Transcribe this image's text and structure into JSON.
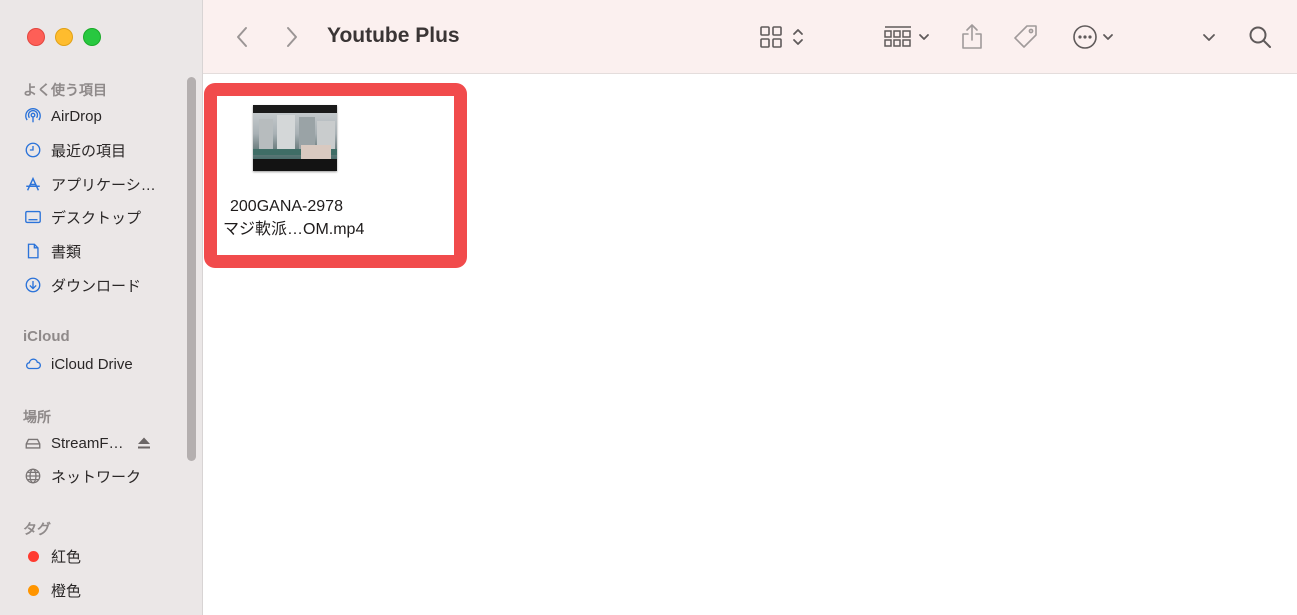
{
  "window": {
    "title": "Youtube Plus"
  },
  "sidebar": {
    "sections": [
      {
        "header": "よく使う項目",
        "items": [
          {
            "label": "AirDrop",
            "icon": "airdrop-icon"
          },
          {
            "label": "最近の項目",
            "icon": "clock-icon"
          },
          {
            "label": "アプリケーシ…",
            "icon": "applications-icon"
          },
          {
            "label": "デスクトップ",
            "icon": "desktop-icon"
          },
          {
            "label": "書類",
            "icon": "document-icon"
          },
          {
            "label": "ダウンロード",
            "icon": "download-icon"
          }
        ]
      },
      {
        "header": "iCloud",
        "items": [
          {
            "label": "iCloud Drive",
            "icon": "cloud-icon"
          }
        ]
      },
      {
        "header": "場所",
        "items": [
          {
            "label": "StreamF…",
            "icon": "drive-icon"
          },
          {
            "label": "ネットワーク",
            "icon": "network-icon"
          }
        ]
      },
      {
        "header": "タグ",
        "items": [
          {
            "label": "紅色",
            "color": "#ff3b30"
          },
          {
            "label": "橙色",
            "color": "#ff9500"
          }
        ]
      }
    ]
  },
  "content": {
    "files": [
      {
        "name_line1": "200GANA-2978",
        "name_line2": "マジ軟派…OM.mp4",
        "selected": true,
        "highlight_color": "#f14b4c"
      }
    ]
  },
  "colors": {
    "accent": "#2b73d9",
    "highlight": "#f14b4c",
    "sidebar_bg": "#ebe7e7",
    "toolbar_bg": "#fbf0ef"
  }
}
